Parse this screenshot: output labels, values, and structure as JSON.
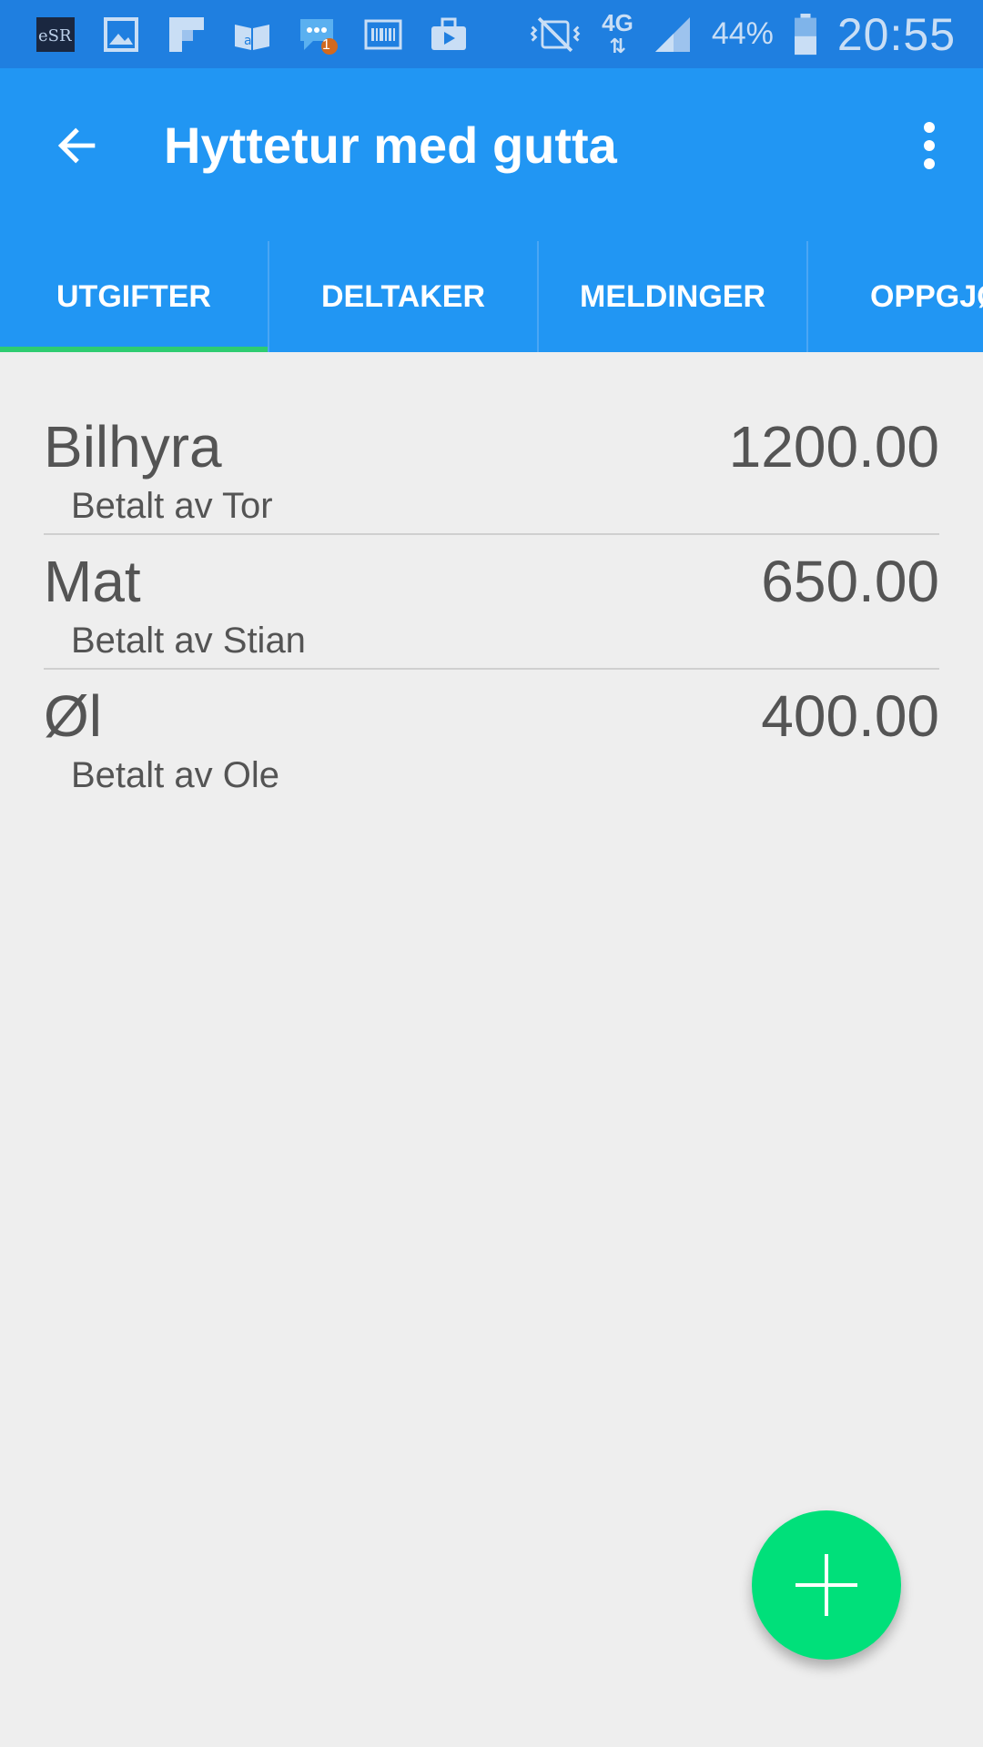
{
  "status_bar": {
    "battery_percent": "44%",
    "time": "20:55",
    "network_type": "4G",
    "notification_badge": "1",
    "icons_left": [
      "app-thumbnail-icon",
      "gallery-icon",
      "flipboard-icon",
      "kindle-icon",
      "messages-icon",
      "barcode-icon",
      "toolbox-icon"
    ],
    "icons_right": [
      "mute-vibrate-icon",
      "network-4g-icon",
      "signal-icon",
      "battery-icon"
    ]
  },
  "colors": {
    "status_bar": "#1f7fe0",
    "app_bar": "#2196f3",
    "tab_indicator": "#2ecc71",
    "fab": "#00e07a",
    "background": "#eeeeee",
    "text": "#545454"
  },
  "toolbar": {
    "title": "Hyttetur med gutta",
    "back_icon": "arrow-back-icon",
    "menu_icon": "more-vert-icon"
  },
  "tabs": [
    {
      "label": "UTGIFTER",
      "active": true
    },
    {
      "label": "DELTAKER",
      "active": false
    },
    {
      "label": "MELDINGER",
      "active": false
    },
    {
      "label": "OPPGJØR",
      "active": false
    }
  ],
  "expenses": [
    {
      "name": "Bilhyra",
      "amount": "1200.00",
      "payer": "Betalt av Tor"
    },
    {
      "name": "Mat",
      "amount": "650.00",
      "payer": "Betalt av Stian"
    },
    {
      "name": "Øl",
      "amount": "400.00",
      "payer": "Betalt av Ole"
    }
  ],
  "fab": {
    "icon": "add-icon"
  }
}
